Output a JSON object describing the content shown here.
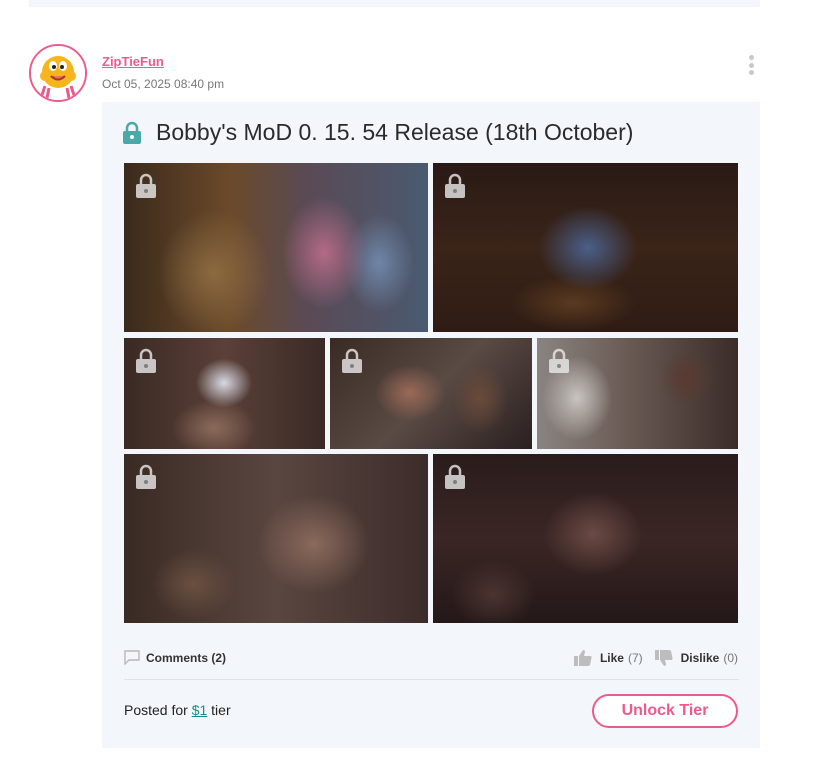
{
  "post": {
    "author": "ZipTieFun",
    "date": "Oct 05, 2025 08:40 pm",
    "title": "Bobby's MoD 0. 15. 54 Release (18th October)",
    "images": [
      {
        "name": "locked-image-1",
        "locked": true
      },
      {
        "name": "locked-image-2",
        "locked": true
      },
      {
        "name": "locked-image-3",
        "locked": true
      },
      {
        "name": "locked-image-4",
        "locked": true
      },
      {
        "name": "locked-image-5",
        "locked": true
      },
      {
        "name": "locked-image-6",
        "locked": true
      },
      {
        "name": "locked-image-7",
        "locked": true
      }
    ],
    "comments_label": "Comments (2)",
    "like_label": "Like",
    "like_count": "(7)",
    "dislike_label": "Dislike",
    "dislike_count": "(0)",
    "posted_prefix": "Posted for ",
    "tier_link": "$1",
    "posted_suffix": " tier",
    "unlock_button": "Unlock Tier"
  },
  "colors": {
    "accent_pink": "#ee5a8a",
    "lock_teal": "#4aa9a8",
    "link_teal": "#1a8c86",
    "card_bg": "#f3f7fb"
  },
  "icons": {
    "menu": "more-vertical-icon",
    "title_lock": "lock-icon",
    "tile_lock": "lock-icon",
    "comments": "comment-icon",
    "like": "thumbs-up-icon",
    "dislike": "thumbs-down-icon"
  }
}
